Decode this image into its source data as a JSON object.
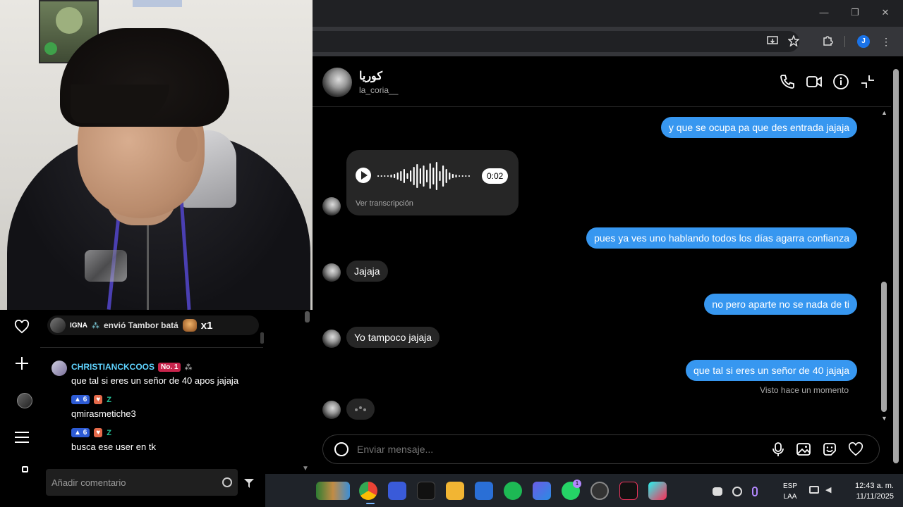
{
  "stream": {
    "gift": {
      "user": "IGNA",
      "action": "envió Tambor batá",
      "count": "x1"
    },
    "comments": [
      {
        "user": "CHRISTIANCKCOOS",
        "badge": "No. 1",
        "text": "que tal si eres un señor de 40 apos jajaja"
      },
      {
        "level": "6",
        "z": "Z",
        "text": "qmirasmetiche3"
      },
      {
        "level": "6",
        "z": "Z",
        "text": "busca ese user en tk"
      }
    ],
    "comment_placeholder": "Añadir comentario"
  },
  "browser": {
    "profile_initial": "J"
  },
  "dm": {
    "contact_name": "كوريا",
    "contact_username": "la_coria__",
    "messages": {
      "m1": "y que se ocupa pa que des entrada jajaja",
      "voice_duration": "0:02",
      "voice_transcript": "Ver transcripción",
      "m2": "pues ya ves uno hablando todos los días agarra confianza",
      "m3": "Jajaja",
      "m4": "no pero aparte no se nada de ti",
      "m5": "Yo tampoco jajaja",
      "m6": "que tal si eres un señor de 40 jajaja",
      "seen": "Visto hace un momento"
    },
    "composer_placeholder": "Enviar mensaje..."
  },
  "taskbar": {
    "lang_line1": "ESP",
    "lang_line2": "LAA",
    "time": "12:43 a. m.",
    "date": "11/11/2025",
    "whatsapp_badge": "1"
  }
}
